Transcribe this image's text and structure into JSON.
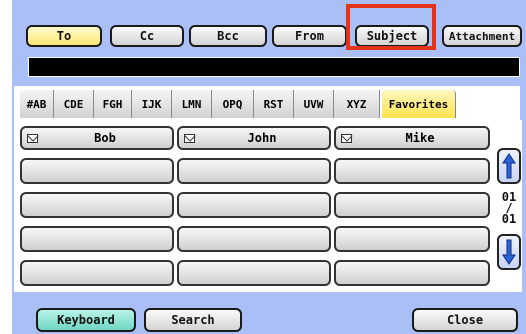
{
  "search_tabs": {
    "to": "To",
    "cc": "Cc",
    "bcc": "Bcc",
    "from": "From",
    "subject": "Subject",
    "attachment": "Attachment"
  },
  "index_tabs": [
    "#AB",
    "CDE",
    "FGH",
    "IJK",
    "LMN",
    "OPQ",
    "RST",
    "UVW",
    "XYZ",
    "Favorites"
  ],
  "contacts": [
    {
      "name": "Bob"
    },
    {
      "name": "John"
    },
    {
      "name": "Mike"
    }
  ],
  "pager": {
    "current": "01",
    "separator": "/",
    "total": "01"
  },
  "bottom": {
    "keyboard": "Keyboard",
    "search": "Search",
    "close": "Close"
  },
  "colors": {
    "panel": "#a9bff5",
    "selected": "#ffe873",
    "highlight": "#e3331b",
    "keyboard": "#6fd6c2"
  }
}
